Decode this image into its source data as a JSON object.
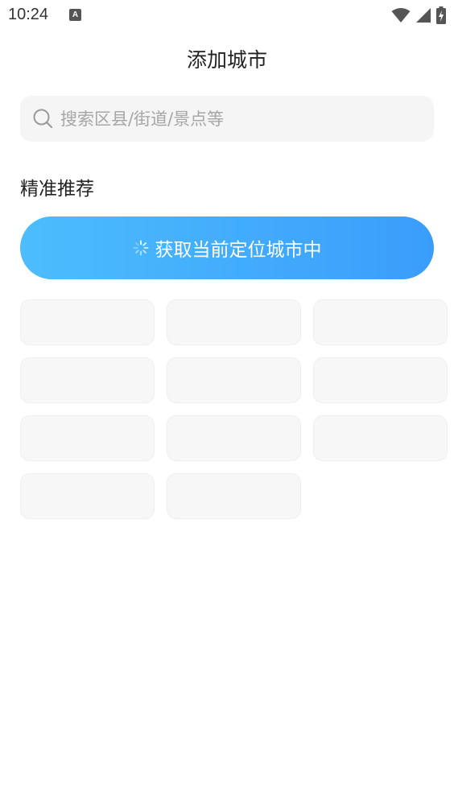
{
  "status_bar": {
    "time": "10:24",
    "notification_icon": "A"
  },
  "page_title": "添加城市",
  "search": {
    "placeholder": "搜索区县/街道/景点等",
    "value": ""
  },
  "recommend": {
    "section_label": "精准推荐",
    "locate_button_label": "获取当前定位城市中"
  },
  "city_placeholders_count": 11,
  "colors": {
    "accent_start": "#4cbdfd",
    "accent_end": "#3a9dfb",
    "placeholder_bg": "#f7f7f7"
  }
}
